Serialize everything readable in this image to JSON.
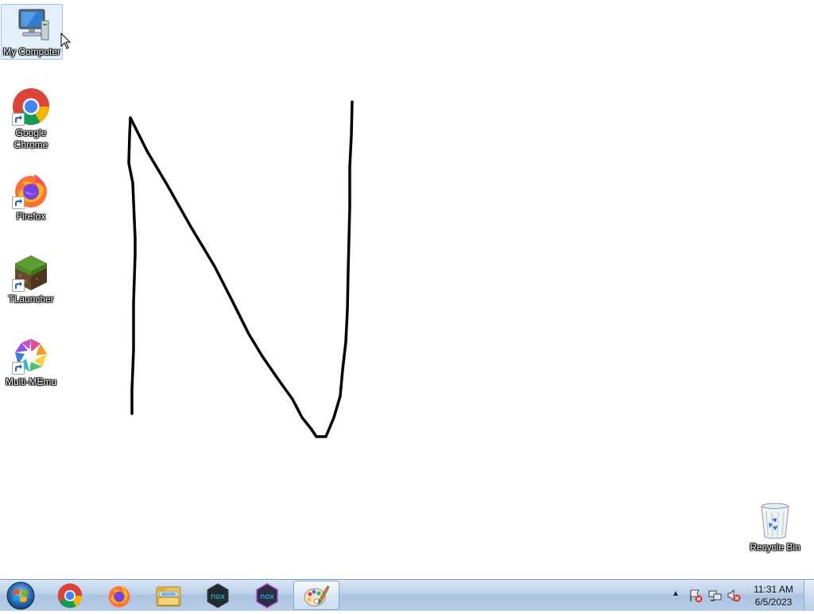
{
  "desktop": {
    "icons": [
      {
        "label": "My Computer",
        "icon": "computer-icon"
      },
      {
        "label": "Google Chrome",
        "icon": "chrome-icon"
      },
      {
        "label": "Firefox",
        "icon": "firefox-icon"
      },
      {
        "label": "TLauncher",
        "icon": "tlauncher-icon"
      },
      {
        "label": "Multi-MEmu",
        "icon": "multi-memu-icon"
      },
      {
        "label": "Recycle Bin",
        "icon": "recycle-bin-icon"
      }
    ],
    "drawing": {
      "content": "hand-drawn letter N",
      "stroke_color": "#000000"
    }
  },
  "taskbar": {
    "start_icon": "windows-start-orb",
    "buttons": [
      {
        "icon": "chrome-icon"
      },
      {
        "icon": "firefox-icon"
      },
      {
        "icon": "file-explorer-icon"
      },
      {
        "icon": "nox-icon"
      },
      {
        "icon": "nox-multi-icon"
      },
      {
        "icon": "paint-icon",
        "active": true
      }
    ],
    "tray": {
      "icons": [
        "show-hidden-icons-arrow",
        "action-center-flag-icon",
        "network-icon",
        "volume-muted-icon"
      ]
    },
    "clock": {
      "time": "11:31 AM",
      "date": "6/5/2023"
    }
  }
}
